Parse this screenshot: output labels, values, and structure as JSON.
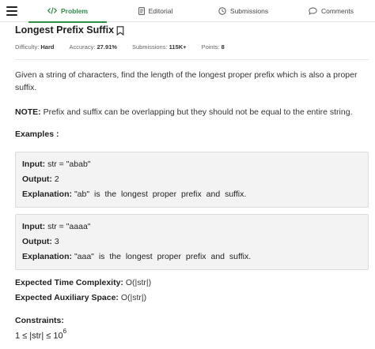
{
  "nav": {
    "tabs": [
      {
        "label": "Problem",
        "icon": "code-icon",
        "active": true
      },
      {
        "label": "Editorial",
        "icon": "document-icon",
        "active": false
      },
      {
        "label": "Submissions",
        "icon": "clock-icon",
        "active": false
      },
      {
        "label": "Comments",
        "icon": "comment-icon",
        "active": false
      }
    ]
  },
  "problem": {
    "title": "Longest Prefix Suffix",
    "difficulty_label": "Difficulty:",
    "difficulty": "Hard",
    "accuracy_label": "Accuracy:",
    "accuracy": "27.91%",
    "submissions_label": "Submissions:",
    "submissions": "115K+",
    "points_label": "Points:",
    "points": "8",
    "description": "Given a string of characters, find the length of the longest proper prefix which is also a proper suffix.",
    "note_label": "NOTE:",
    "note": "Prefix and suffix can be overlapping but they should not be equal to the entire string.",
    "examples_heading": "Examples :",
    "examples": [
      {
        "input_label": "Input:",
        "input": "str = \"abab\"",
        "output_label": "Output:",
        "output": "2",
        "explanation_label": "Explanation:",
        "explanation": "\"ab\" is the longest proper prefix and suffix."
      },
      {
        "input_label": "Input:",
        "input": "str = \"aaaa\"",
        "output_label": "Output:",
        "output": "3",
        "explanation_label": "Explanation:",
        "explanation": "\"aaa\" is the longest proper prefix and suffix."
      }
    ],
    "time_label": "Expected Time Complexity:",
    "time": "O(|str|)",
    "space_label": "Expected Auxiliary Space:",
    "space": "O(|str|)",
    "constraints_heading": "Constraints:",
    "constraint_base": "1 ≤ |str| ≤ 10",
    "constraint_exp": "6"
  },
  "colors": {
    "accent": "#2f8d46",
    "example_bg": "#f3f3f3"
  }
}
